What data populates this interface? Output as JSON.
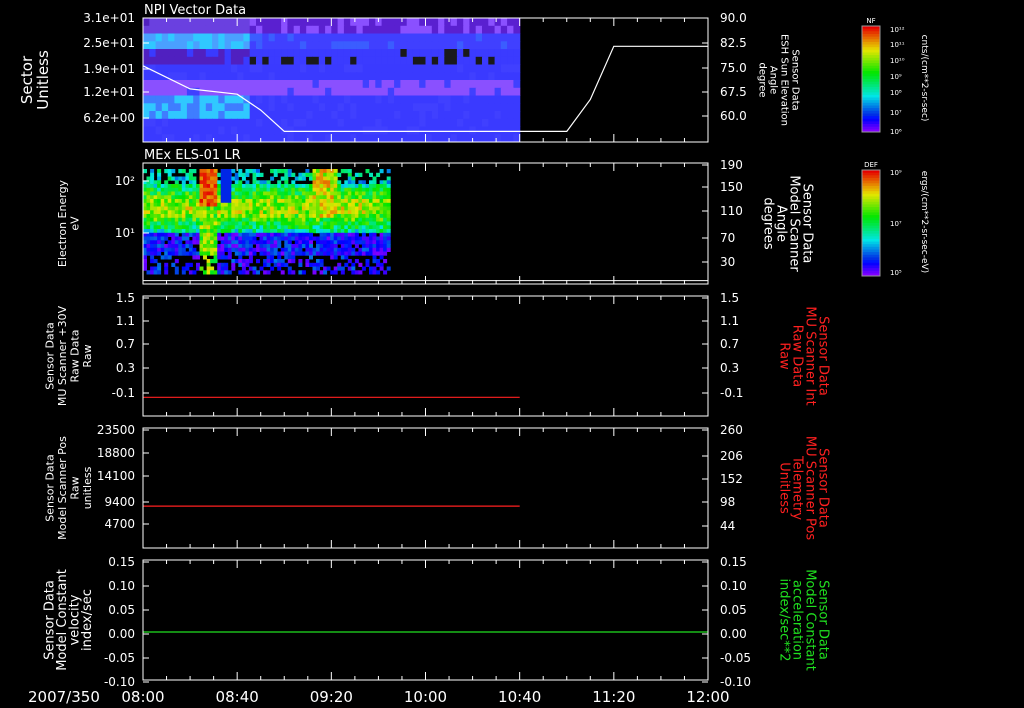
{
  "date_label": "2007/350",
  "time_ticks": [
    "08:00",
    "08:40",
    "09:20",
    "10:00",
    "10:40",
    "11:20",
    "12:00"
  ],
  "panels": [
    {
      "id": "p1",
      "title": "NPI Vector Data",
      "left_ticks": [
        "3.1e+01",
        "2.5e+01",
        "1.9e+01",
        "1.2e+01",
        "6.2e+00"
      ],
      "left_label": [
        "Sector",
        "Unitless"
      ],
      "right_ticks": [
        "90.0",
        "82.5",
        "75.0",
        "67.5",
        "60.0"
      ],
      "right_label": [
        "Sensor Data",
        "ESH Sun Elevation",
        "Angle",
        "degree"
      ],
      "right_color": "#ffffff"
    },
    {
      "id": "p2",
      "title": "MEx ELS-01 LR",
      "left_ticks": [
        "10²",
        "10¹"
      ],
      "left_label": [
        "Electron Energy",
        "eV"
      ],
      "right_ticks": [
        "190",
        "150",
        "110",
        "70",
        "30"
      ],
      "right_label": [
        "Sensor Data",
        "Model Scanner",
        "Angle",
        "degrees"
      ],
      "right_color": "#ffffff"
    },
    {
      "id": "p3",
      "title": "",
      "left_ticks": [
        "1.5",
        "1.1",
        "0.7",
        "0.3",
        "-0.1"
      ],
      "left_label": [
        "Sensor Data",
        "MU Scanner +30V",
        "Raw Data",
        "Raw"
      ],
      "right_ticks": [
        "1.5",
        "1.1",
        "0.7",
        "0.3",
        "-0.1"
      ],
      "right_label": [
        "Sensor Data",
        "MU Scanner Int",
        "Raw Data",
        "Raw"
      ],
      "right_color": "#ff2020"
    },
    {
      "id": "p4",
      "title": "",
      "left_ticks": [
        "23500",
        "18800",
        "14100",
        "9400",
        "4700"
      ],
      "left_label": [
        "Sensor Data",
        "Model Scanner Pos",
        "Raw",
        "unitless"
      ],
      "right_ticks": [
        "260",
        "206",
        "152",
        "98",
        "44"
      ],
      "right_label": [
        "Sensor Data",
        "MU Scanner Pos",
        "Telemetry",
        "Unitless"
      ],
      "right_color": "#ff2020"
    },
    {
      "id": "p5",
      "title": "",
      "left_ticks": [
        "0.15",
        "0.10",
        "0.05",
        "0.00",
        "-0.05",
        "-0.10"
      ],
      "left_label": [
        "Sensor Data",
        "Model Constant",
        "velocity",
        "index/sec"
      ],
      "right_ticks": [
        "0.15",
        "0.10",
        "0.05",
        "0.00",
        "-0.05",
        "-0.10"
      ],
      "right_label": [
        "Sensor Data",
        "Model Constant",
        "acceleration",
        "index/sec**2"
      ],
      "right_color": "#20e020"
    }
  ],
  "colorbars": [
    {
      "id": "cb1",
      "name": "NF",
      "ticks": [
        "10¹²",
        "10¹¹",
        "10¹⁰",
        "10⁹",
        "10⁸",
        "10⁷",
        "10⁶"
      ],
      "units": "cnts/(cm**2-sr-sec)"
    },
    {
      "id": "cb2",
      "name": "DEF",
      "ticks": [
        "10⁹",
        "10⁷",
        "10⁵"
      ],
      "units": "ergs/(cm**2-sr-sec-eV)"
    }
  ],
  "chart_data": [
    {
      "type": "heatmap",
      "title": "NPI Vector Data",
      "x_range": [
        "08:00",
        "12:00"
      ],
      "ylabel": "Sector Unitless",
      "data_end": "10:40",
      "series": [
        {
          "name": "ESH Sun Elevation Angle",
          "type": "line",
          "axis": "right",
          "ylim": [
            55,
            90
          ],
          "x": [
            "08:00",
            "08:20",
            "08:40",
            "08:50",
            "09:00",
            "10:00",
            "11:00",
            "11:10",
            "11:20",
            "12:00"
          ],
          "values": [
            76.5,
            70,
            68.5,
            64,
            58,
            58,
            58,
            67,
            82,
            82
          ]
        }
      ]
    },
    {
      "type": "heatmap",
      "title": "MEx ELS-01 LR",
      "ylabel": "Electron Energy eV",
      "y_scale": "log",
      "data_end": "09:45",
      "series": [
        {
          "name": "Model Scanner Angle",
          "type": "line",
          "axis": "right",
          "ylim": [
            10,
            190
          ],
          "x": [
            "08:00",
            "12:00"
          ],
          "values": [
            15,
            15
          ]
        }
      ]
    },
    {
      "type": "line",
      "ylim": [
        -0.3,
        1.5
      ],
      "series": [
        {
          "name": "MU Scanner +30V Raw Data",
          "color": "#ff2020",
          "x": [
            "08:00",
            "10:40"
          ],
          "values": [
            -0.02,
            -0.02
          ]
        }
      ]
    },
    {
      "type": "line",
      "ylim": [
        0,
        23500
      ],
      "series": [
        {
          "name": "Model Scanner Pos",
          "color": "#ff2020",
          "x": [
            "08:00",
            "10:40"
          ],
          "values": [
            8200,
            8200
          ]
        }
      ]
    },
    {
      "type": "line",
      "ylim": [
        -0.1,
        0.15
      ],
      "series": [
        {
          "name": "Model Constant velocity",
          "color": "#20e020",
          "x": [
            "08:00",
            "12:00"
          ],
          "values": [
            0,
            0
          ]
        }
      ]
    }
  ]
}
